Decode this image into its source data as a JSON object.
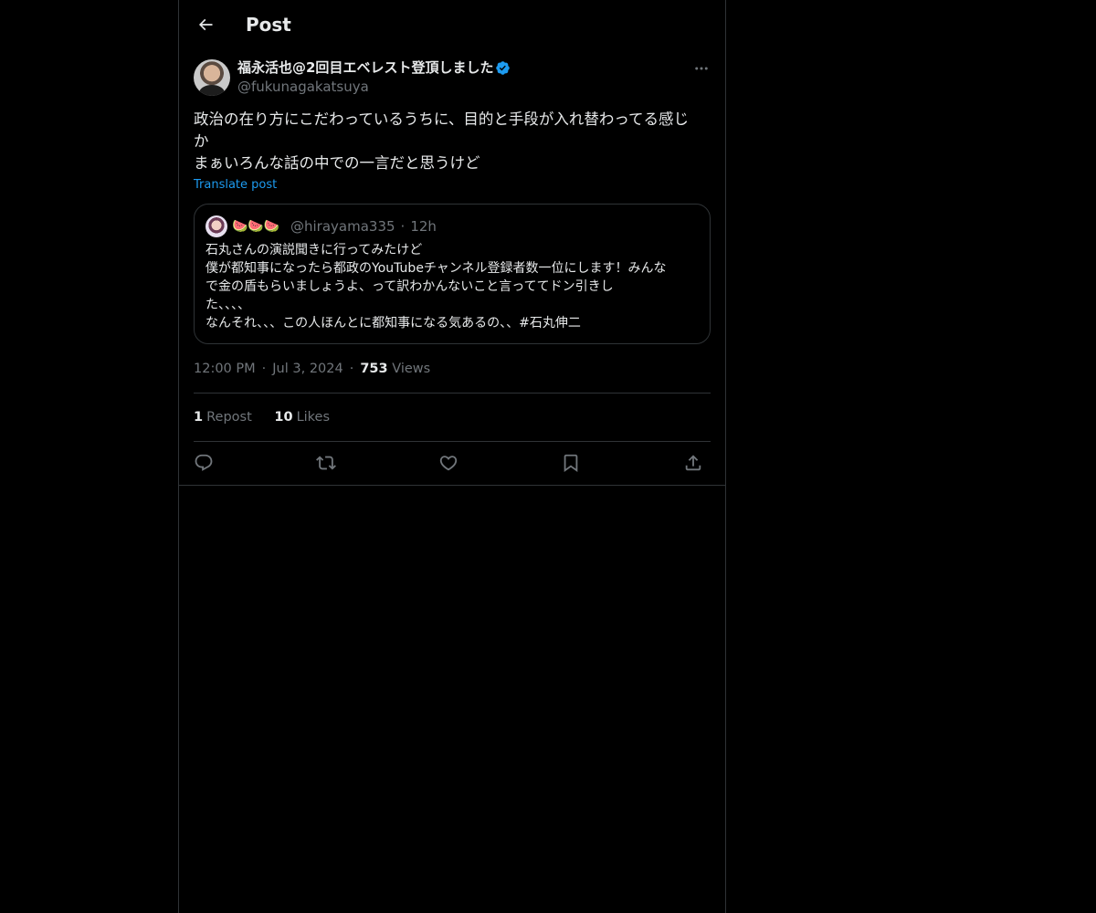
{
  "header": {
    "title": "Post",
    "back_icon": "arrow-left-icon"
  },
  "post": {
    "author_name": "福永活也@2回目エベレスト登頂しました",
    "handle": "@fukunagakatsuya",
    "verified_color": "#1d9bf0",
    "text_lines": [
      "政治の在り方にこだわっているうちに、目的と手段が入れ替わってる感じ",
      "か",
      "まぁいろんな話の中での一言だと思うけど"
    ],
    "translate_label": "Translate post",
    "time": "12:00 PM",
    "date": "Jul 3, 2024",
    "views_count": "753",
    "views_label": "Views",
    "reposts_count": "1",
    "reposts_label": "Repost",
    "likes_count": "10",
    "likes_label": "Likes"
  },
  "quote": {
    "name": "🍉🍉🍉",
    "handle": "@hirayama335",
    "time": "12h",
    "text_lines": [
      "石丸さんの演説聞きに行ってみたけど",
      "僕が都知事になったら都政のYouTubeチャンネル登録者数一位にします！みんな",
      "で金の盾もらいましょうよ、って訳わかんないこと言っててドン引きし",
      "た、、、、",
      "なんそれ、、、この人ほんとに都知事になる気あるの、、#石丸伸二"
    ]
  },
  "actions": [
    "reply-icon",
    "repost-icon",
    "like-icon",
    "bookmark-icon",
    "share-icon"
  ],
  "colors": {
    "background": "#000000",
    "text": "#e7e9ea",
    "secondary": "#71767b",
    "border": "#2f3336",
    "accent": "#1d9bf0"
  }
}
